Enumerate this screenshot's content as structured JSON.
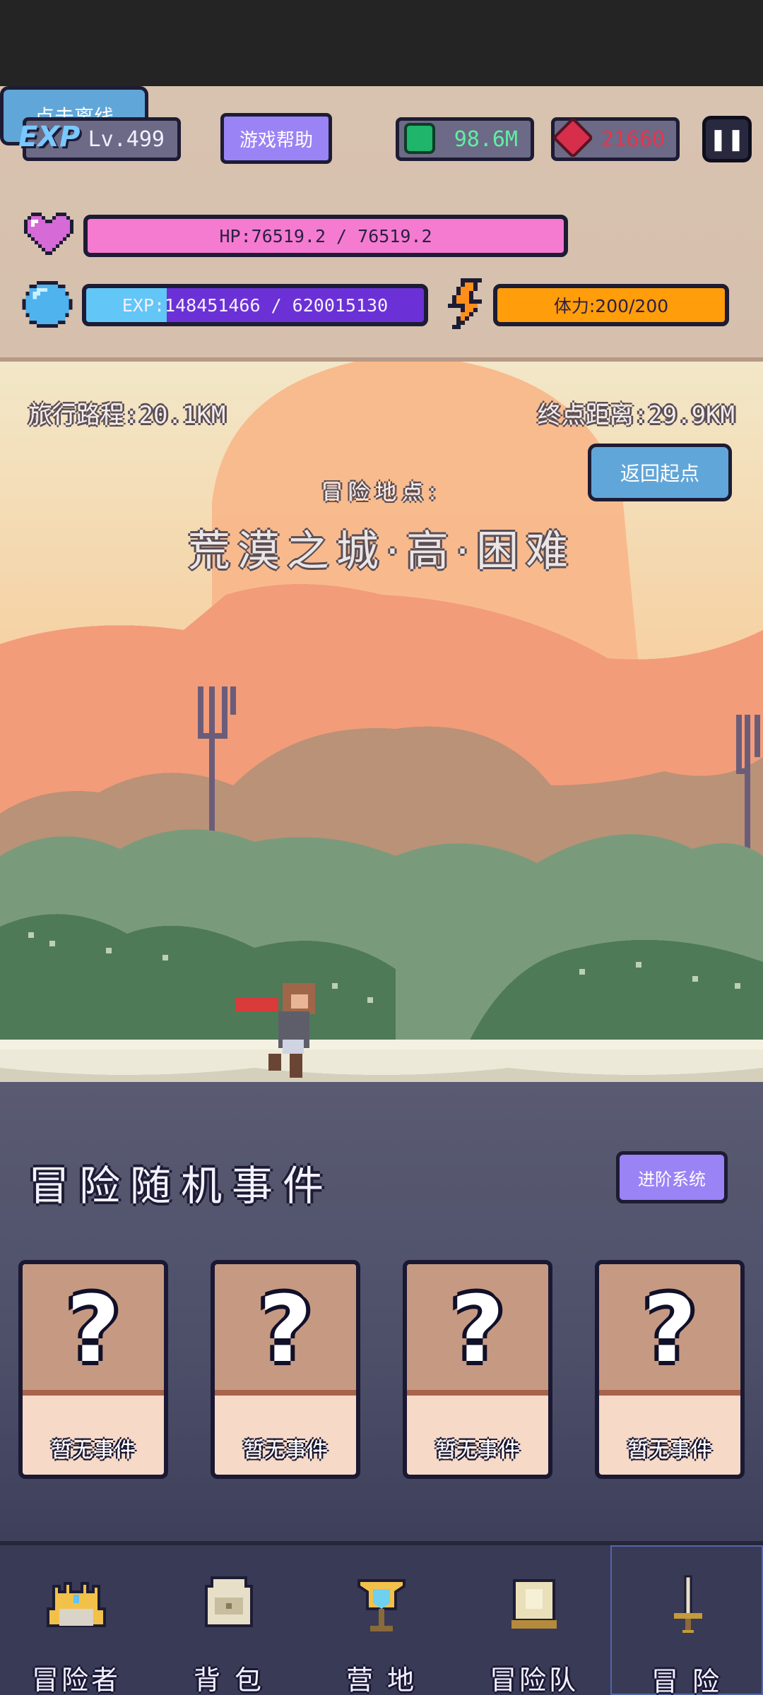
{
  "hud": {
    "exp_logo": "EXP",
    "level": "Lv.499",
    "help_label": "游戏帮助",
    "emerald": "98.6M",
    "ruby": "21660",
    "pause_symbol": "❚❚",
    "hp_text": "HP:76519.2 / 76519.2",
    "hp_fraction": 1.0,
    "exp_text": "EXP:148451466 / 620015130",
    "exp_fraction": 0.239,
    "stamina_text": "体力:200/200",
    "stamina_fraction": 1.0,
    "offline_label": "点击离线",
    "icons": {
      "hp": "heart-icon",
      "exp": "crystal-orb-icon",
      "stamina": "lightning-icon",
      "emerald": "emerald-icon",
      "ruby": "ruby-icon"
    },
    "colors": {
      "hp": "#f57bd0",
      "exp": "#62c6f7",
      "stamina": "#ff9d0a"
    }
  },
  "scene": {
    "trip_distance": "旅行路程:20.1KM",
    "end_distance": "终点距离:29.9KM",
    "return_label": "返回起点",
    "location_label": "冒险地点:",
    "location_name": "荒漠之城·高·困难"
  },
  "events": {
    "title": "冒险随机事件",
    "advance_label": "进阶系统",
    "cards": [
      {
        "symbol": "?",
        "label": "暂无事件"
      },
      {
        "symbol": "?",
        "label": "暂无事件"
      },
      {
        "symbol": "?",
        "label": "暂无事件"
      },
      {
        "symbol": "?",
        "label": "暂无事件"
      }
    ]
  },
  "nav": {
    "items": [
      {
        "label": "冒险者",
        "icon": "crown-helmet-icon"
      },
      {
        "label": "背 包",
        "icon": "backpack-icon"
      },
      {
        "label": "营 地",
        "icon": "camp-banner-icon"
      },
      {
        "label": "冒险队",
        "icon": "guild-book-icon"
      },
      {
        "label": "冒 险",
        "icon": "sword-icon",
        "active": true
      }
    ]
  }
}
